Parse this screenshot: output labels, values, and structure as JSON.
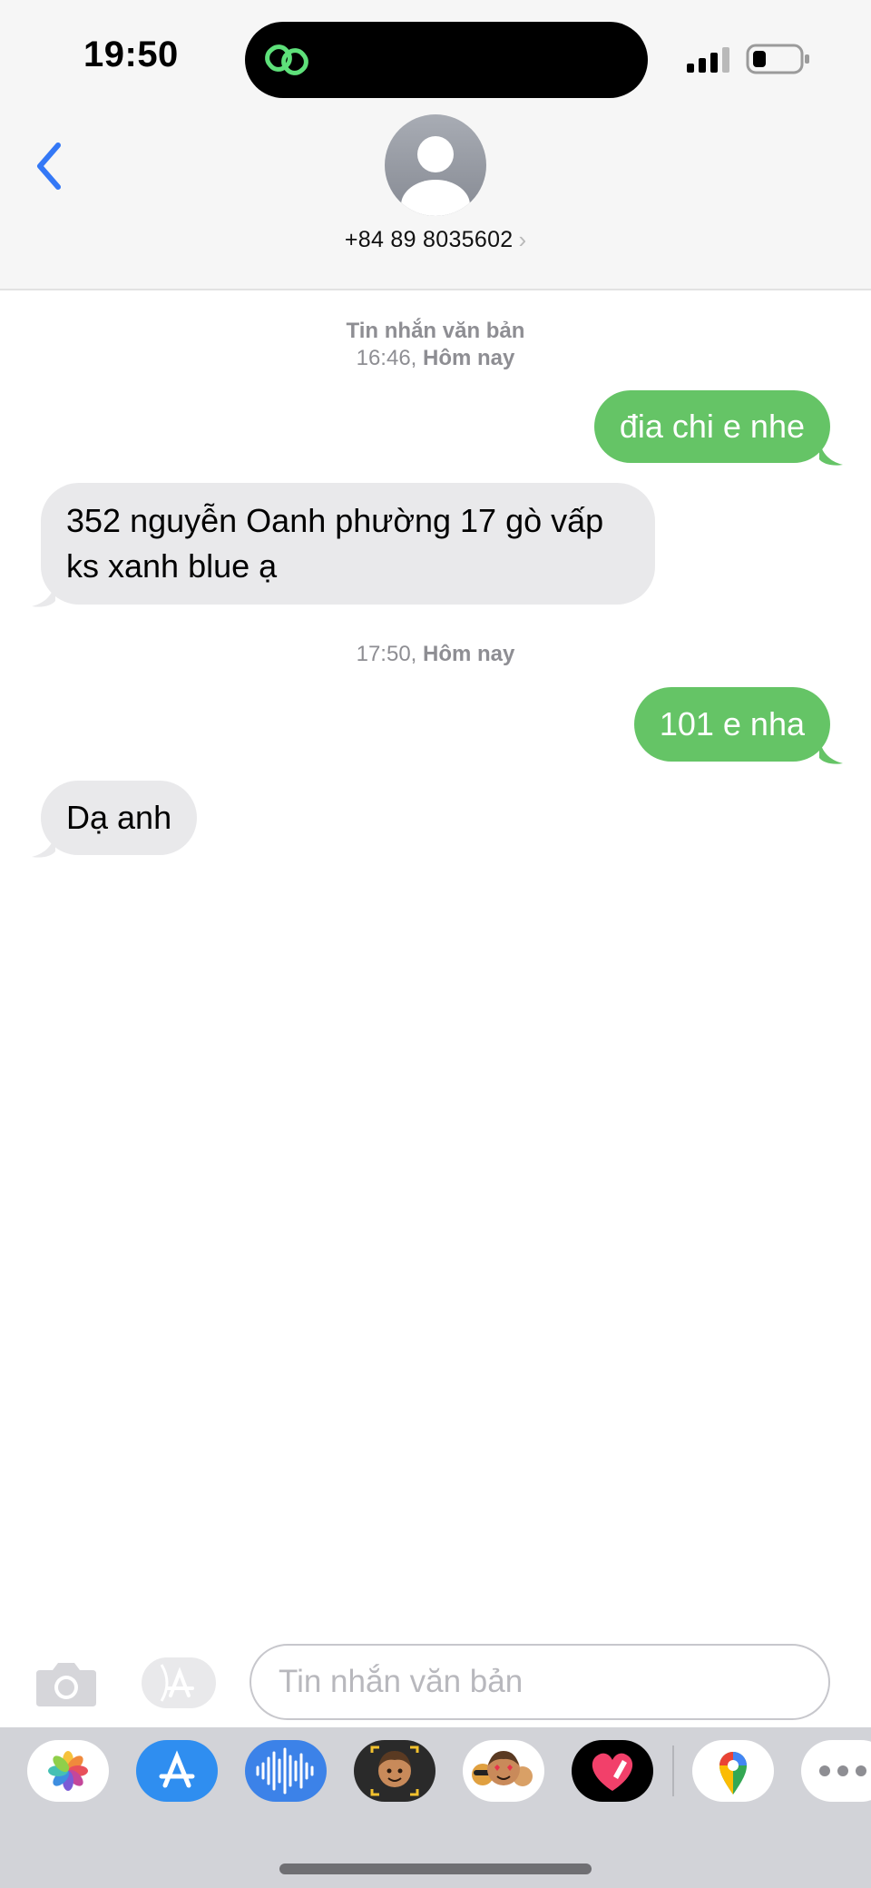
{
  "status_bar": {
    "time": "19:50"
  },
  "header": {
    "contact_number": "+84 89 8035602"
  },
  "messages": [
    {
      "type": "timestamp",
      "line1": "Tin nhắn văn bản",
      "time": "16:46,",
      "day": "Hôm nay"
    },
    {
      "type": "out",
      "text": "đia chi e nhe"
    },
    {
      "type": "in",
      "line1": "352 nguyễn Oanh phường 17 gò vấp",
      "line2": "ks xanh blue ạ"
    },
    {
      "type": "timestamp",
      "time": "17:50,",
      "day": "Hôm nay"
    },
    {
      "type": "out",
      "text": "101 e nha"
    },
    {
      "type": "in",
      "text": "Dạ anh"
    }
  ],
  "composer": {
    "placeholder": "Tin nhắn văn bản",
    "value": ""
  },
  "app_drawer": {
    "icons": [
      "photos-icon",
      "app-store-icon",
      "audio-message-icon",
      "memoji-icon",
      "animoji-stickers-icon",
      "digital-touch-icon",
      "google-maps-icon",
      "more-icon"
    ]
  },
  "colors": {
    "outgoing_bubble": "#65c466",
    "incoming_bubble": "#e9e9eb",
    "accent": "#3478f6",
    "header_bg": "#f6f6f6",
    "drawer_bg": "#d2d3d8"
  }
}
